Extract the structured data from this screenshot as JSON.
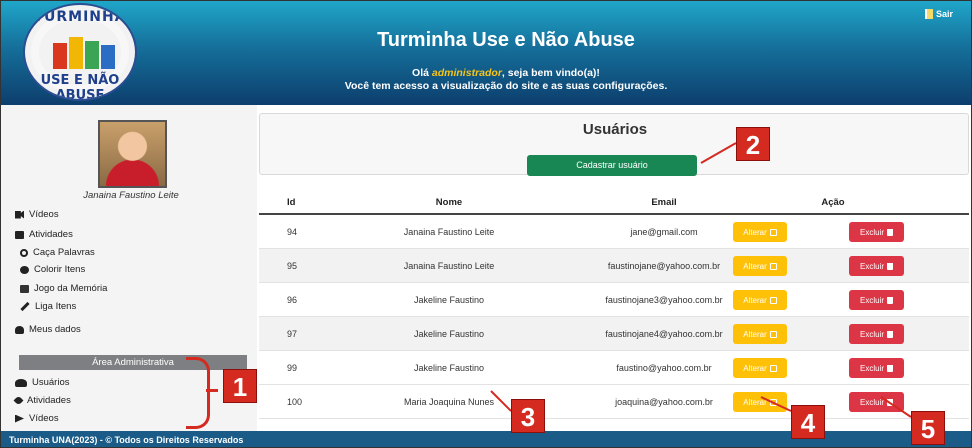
{
  "header": {
    "site_title": "Turminha Use e Não Abuse",
    "greeting_prefix": "Olá ",
    "greeting_user": "administrador",
    "greeting_suffix": ", seja bem vindo(a)!",
    "access_line": "Você tem acesso a visualização do site e as suas configurações.",
    "logout_label": "Sair",
    "logo_top_text": "TURMINHA",
    "logo_bottom_text": "USE E NÃO ABUSE"
  },
  "sidebar": {
    "user_name": "Janaina Faustino Leite",
    "items": [
      {
        "label": "Vídeos",
        "icon": "video-icon"
      },
      {
        "label": "Atividades",
        "icon": "print-icon"
      },
      {
        "label": "Caça Palavras",
        "icon": "search-icon"
      },
      {
        "label": "Colorir Itens",
        "icon": "palette-icon"
      },
      {
        "label": "Jogo da Memória",
        "icon": "photo-icon"
      },
      {
        "label": "Liga Itens",
        "icon": "pencil-icon"
      },
      {
        "label": "Meus dados",
        "icon": "user-icon"
      }
    ],
    "admin_header": "Área Administrativa",
    "admin_items": [
      {
        "label": "Usuários",
        "icon": "users-icon"
      },
      {
        "label": "Atividades",
        "icon": "leaf-icon"
      },
      {
        "label": "Vídeos",
        "icon": "play-icon"
      }
    ]
  },
  "main": {
    "title": "Usuários",
    "register_button": "Cadastrar usuário",
    "columns": [
      "Id",
      "Nome",
      "Email",
      "Ação"
    ],
    "edit_label": "Alterar",
    "delete_label": "Excluir",
    "rows": [
      {
        "id": "94",
        "name": "Janaina Faustino Leite",
        "email": "jane@gmail.com"
      },
      {
        "id": "95",
        "name": "Janaina Faustino Leite",
        "email": "faustinojane@yahoo.com.br"
      },
      {
        "id": "96",
        "name": "Jakeline Faustino",
        "email": "faustinojane3@yahoo.com.br"
      },
      {
        "id": "97",
        "name": "Jakeline Faustino",
        "email": "faustinojane4@yahoo.com.br"
      },
      {
        "id": "99",
        "name": "Jakeline Faustino",
        "email": "faustino@yahoo.com.br"
      },
      {
        "id": "100",
        "name": "Maria Joaquina Nunes",
        "email": "joaquina@yahoo.com.br"
      }
    ]
  },
  "footer": {
    "text": "Turminha UNA(2023) - © Todos os Direitos Reservados"
  },
  "annotations": {
    "callout_1": "1",
    "callout_2": "2",
    "callout_3": "3",
    "callout_4": "4",
    "callout_5": "5",
    "color": "#d42a20"
  },
  "colors": {
    "header_top": "#1fa6c9",
    "header_bottom": "#0d3e6d",
    "success": "#198754",
    "warning": "#ffc107",
    "danger": "#dc3545",
    "footer": "#1a5b87",
    "admin_header": "#7d7f82"
  }
}
